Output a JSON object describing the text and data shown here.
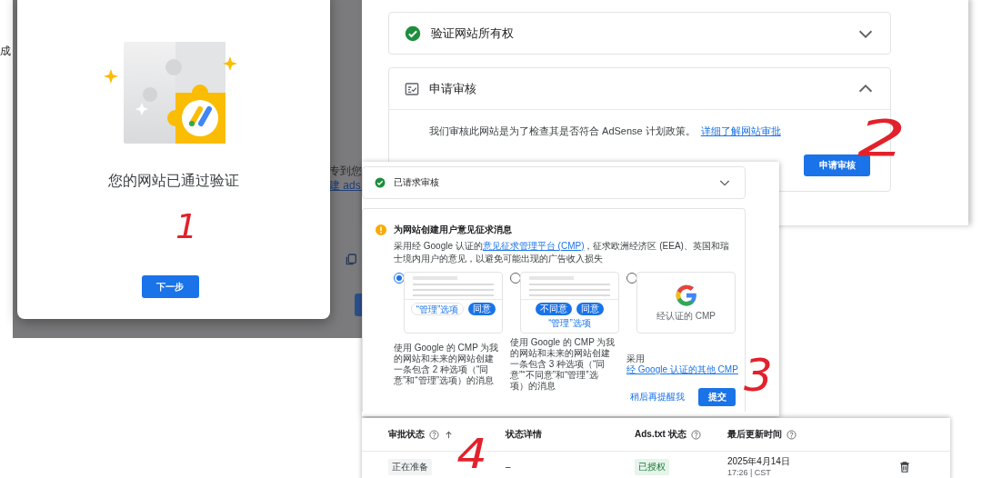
{
  "backdrop_fragments": [
    {
      "kind": "text",
      "text": "成"
    },
    {
      "kind": "text",
      "text": "专到您"
    },
    {
      "kind": "link",
      "text": "建 ads."
    }
  ],
  "verified_dialog": {
    "title": "您的网站已通过验证",
    "button": "下一步"
  },
  "review_panel": {
    "steps": [
      {
        "kind": "done",
        "title": "验证网站所有权",
        "expanded": false
      },
      {
        "kind": "checklist",
        "title": "申请审核",
        "expanded": true,
        "body": {
          "text": "我们审核此网站是为了检查其是否符合 AdSense 计划政策。",
          "link": "详细了解网站审批"
        },
        "button": "申请审核"
      }
    ]
  },
  "consent_panel": {
    "requested_step": {
      "title": "已请求审核",
      "expanded": false
    },
    "message": {
      "title": "为网站创建用户意见征求消息",
      "description": {
        "before": "采用经 Google 认证的",
        "link": "意见征求管理平台 (CMP)",
        "after": "，征求欧洲经济区 (EEA)、英国和瑞士境内用户的意见，以避免可能出现的广告收入损失"
      },
      "options": [
        {
          "kind": "preview",
          "selected": true,
          "preview_buttons": [
            {
              "label": "“管理”选项",
              "primary": false
            },
            {
              "label": "同意",
              "primary": true
            }
          ],
          "description": {
            "before": "使用 Google 的 CMP 为我的网站和未来的网站创建一条包含 2 种选项（“同意”和“管理”选项）的消息"
          }
        },
        {
          "kind": "preview",
          "selected": false,
          "preview_buttons": [
            {
              "label": "不同意",
              "primary": true
            },
            {
              "label": "同意",
              "primary": true
            },
            {
              "label": "“管理”选项",
              "primary": false
            }
          ],
          "description": {
            "before": "使用 Google 的 CMP 为我的网站和未来的网站创建一条包含 3 种选项（“同意”“不同意”和“管理”选项）的消息"
          }
        },
        {
          "kind": "logo",
          "selected": false,
          "caption": "经认证的 CMP",
          "description": {
            "before": "采用",
            "link": "经 Google 认证的其他 CMP"
          }
        }
      ],
      "secondary_button": "稍后再提醒我",
      "primary_button": "提交"
    }
  },
  "sites_table": {
    "columns": [
      {
        "label": "审批状态",
        "help": true,
        "sorted": true
      },
      {
        "label": "状态详情",
        "help": false
      },
      {
        "label": "Ads.txt 状态",
        "help": true
      },
      {
        "label": "最后更新时间",
        "help": true
      }
    ],
    "rows": [
      {
        "cells": [
          {
            "kind": "neutral_chip",
            "text": "正在准备"
          },
          {
            "kind": "text",
            "text": "–"
          },
          {
            "kind": "success_chip",
            "text": "已授权"
          },
          {
            "kind": "datetime",
            "date": "2025年4月14日",
            "time": "17:26 | CST"
          },
          {
            "kind": "delete"
          }
        ]
      }
    ]
  },
  "annotations": [
    {
      "text": "1"
    },
    {
      "text": "2"
    },
    {
      "text": "3"
    },
    {
      "text": "4"
    }
  ]
}
